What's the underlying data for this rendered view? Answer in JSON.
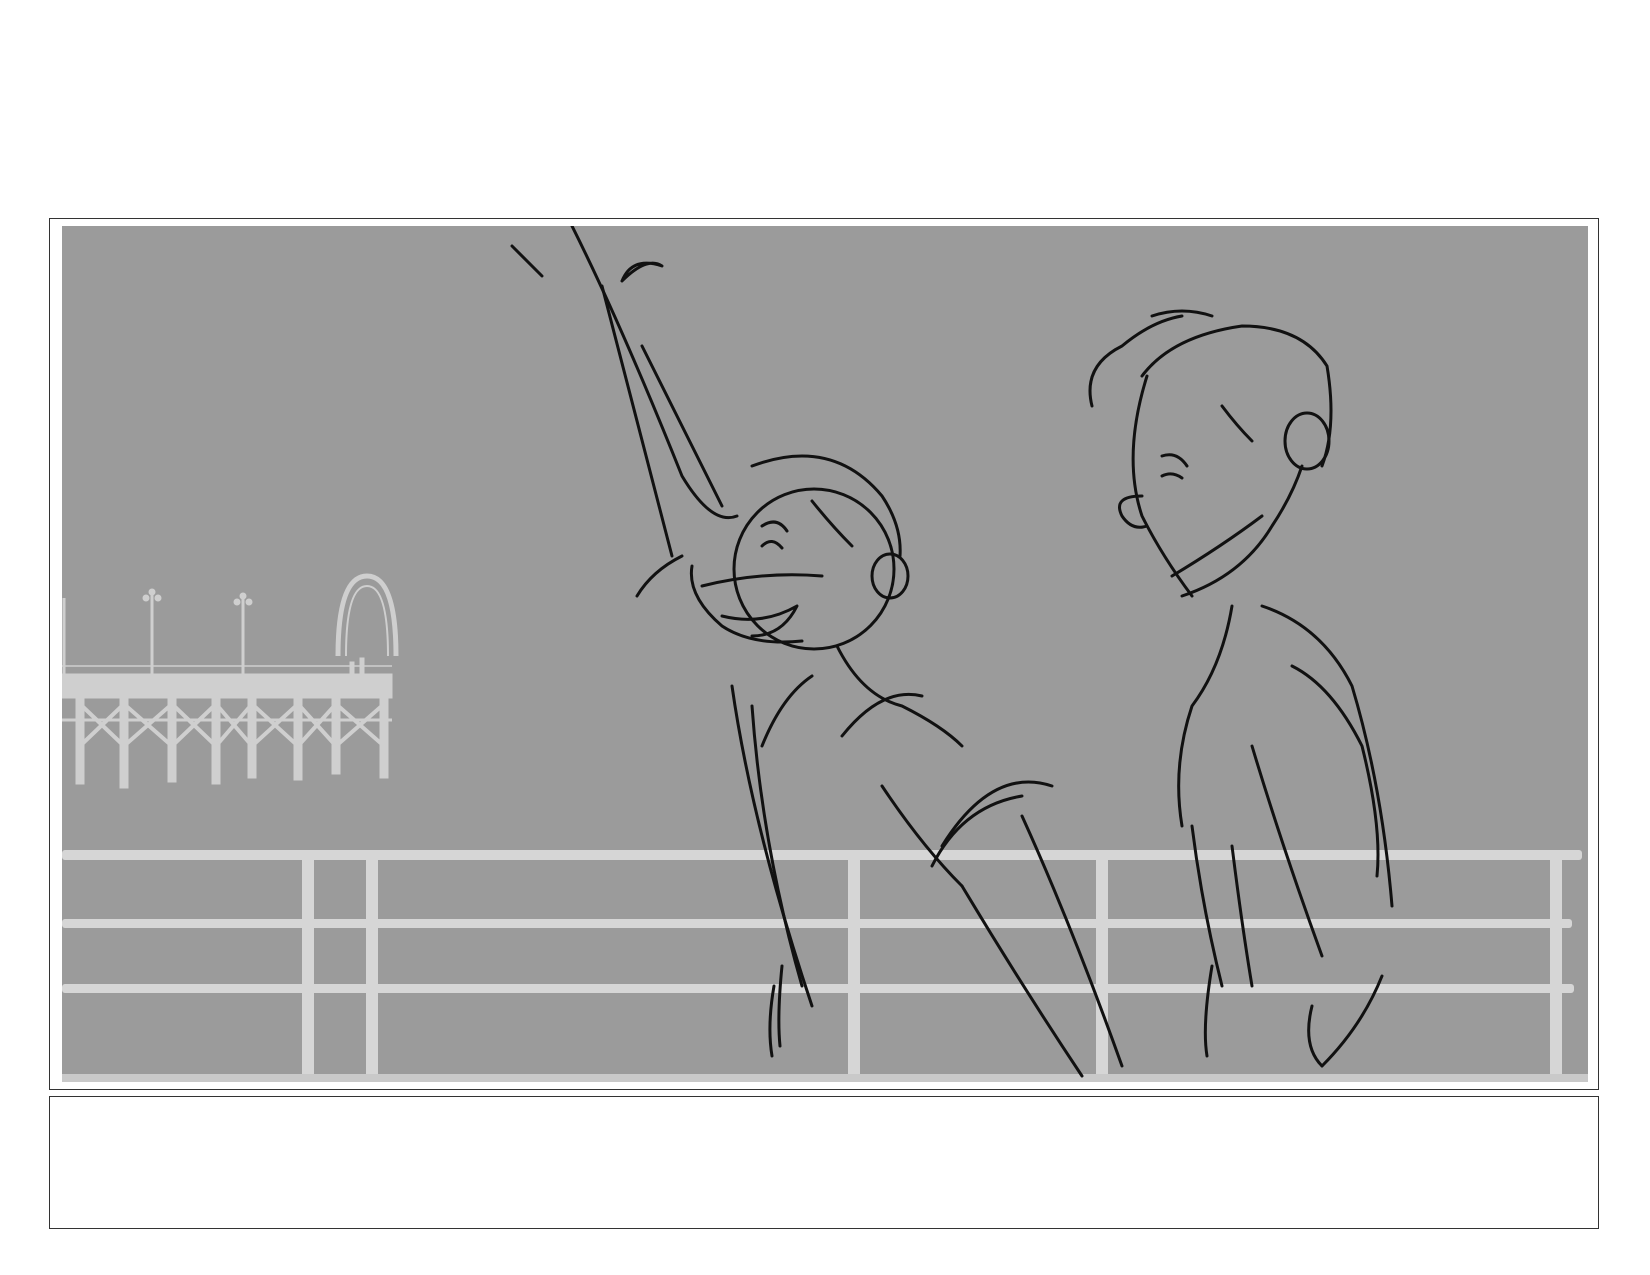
{
  "storyboard": {
    "panel": {
      "scene": "boardwalk-pier",
      "background_color": "#9b9b9b",
      "railing_color": "#d6d6d6",
      "pier_color": "#cfcfcf",
      "line_color": "#111111"
    },
    "caption": {
      "text": ""
    }
  }
}
